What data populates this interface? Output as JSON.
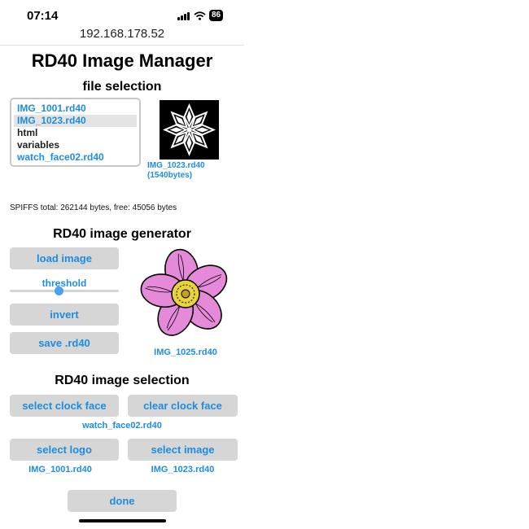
{
  "status_bar": {
    "time": "07:14",
    "battery": "86"
  },
  "browser": {
    "url": "192.168.178.52"
  },
  "page": {
    "title": "RD40 Image Manager"
  },
  "file_selection": {
    "heading": "file selection",
    "files": [
      {
        "name": "IMG_1001.rd40",
        "link": true,
        "selected": false
      },
      {
        "name": "IMG_1023.rd40",
        "link": true,
        "selected": true
      },
      {
        "name": "html",
        "link": false,
        "selected": false
      },
      {
        "name": "variables",
        "link": false,
        "selected": false
      },
      {
        "name": "watch_face02.rd40",
        "link": true,
        "selected": false
      }
    ],
    "preview_name": "IMG_1023.rd40",
    "preview_size": "(1540bytes)"
  },
  "spiffs": {
    "text": "SPIFFS total: 262144 bytes, free: 45056 bytes"
  },
  "generator": {
    "heading": "RD40 image generator",
    "load_label": "load image",
    "threshold_label": "threshold",
    "threshold_value": 0.45,
    "invert_label": "invert",
    "save_label": "save .rd40",
    "preview_name": "IMG_1025.rd40"
  },
  "selection": {
    "heading": "RD40 image selection",
    "clock_face_label": "select clock face",
    "clear_clock_face_label": "clear clock face",
    "clock_face_file": "watch_face02.rd40",
    "logo_label": "select logo",
    "logo_file": "IMG_1001.rd40",
    "image_label": "select image",
    "image_file": "IMG_1023.rd40"
  },
  "footer": {
    "done_label": "done"
  },
  "colors": {
    "accent": "#1e8ce0",
    "button_bg": "#d6d6d6"
  }
}
